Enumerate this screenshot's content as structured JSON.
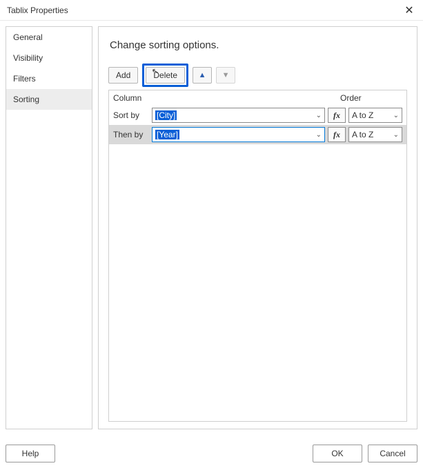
{
  "window": {
    "title": "Tablix Properties"
  },
  "sidebar": {
    "items": [
      {
        "label": "General",
        "selected": false
      },
      {
        "label": "Visibility",
        "selected": false
      },
      {
        "label": "Filters",
        "selected": false
      },
      {
        "label": "Sorting",
        "selected": true
      }
    ]
  },
  "panel": {
    "heading": "Change sorting options."
  },
  "toolbar": {
    "add_label": "Add",
    "delete_label": "Delete",
    "move_up_icon": "▲",
    "move_down_icon": "▼"
  },
  "grid": {
    "column_header": "Column",
    "order_header": "Order",
    "rows": [
      {
        "label": "Sort by",
        "value": "[City]",
        "order": "A to Z",
        "selected": false,
        "highlight_value": true
      },
      {
        "label": "Then by",
        "value": "[Year]",
        "order": "A to Z",
        "selected": true,
        "highlight_value": true
      }
    ]
  },
  "footer": {
    "help_label": "Help",
    "ok_label": "OK",
    "cancel_label": "Cancel"
  },
  "fx_label": "fx"
}
